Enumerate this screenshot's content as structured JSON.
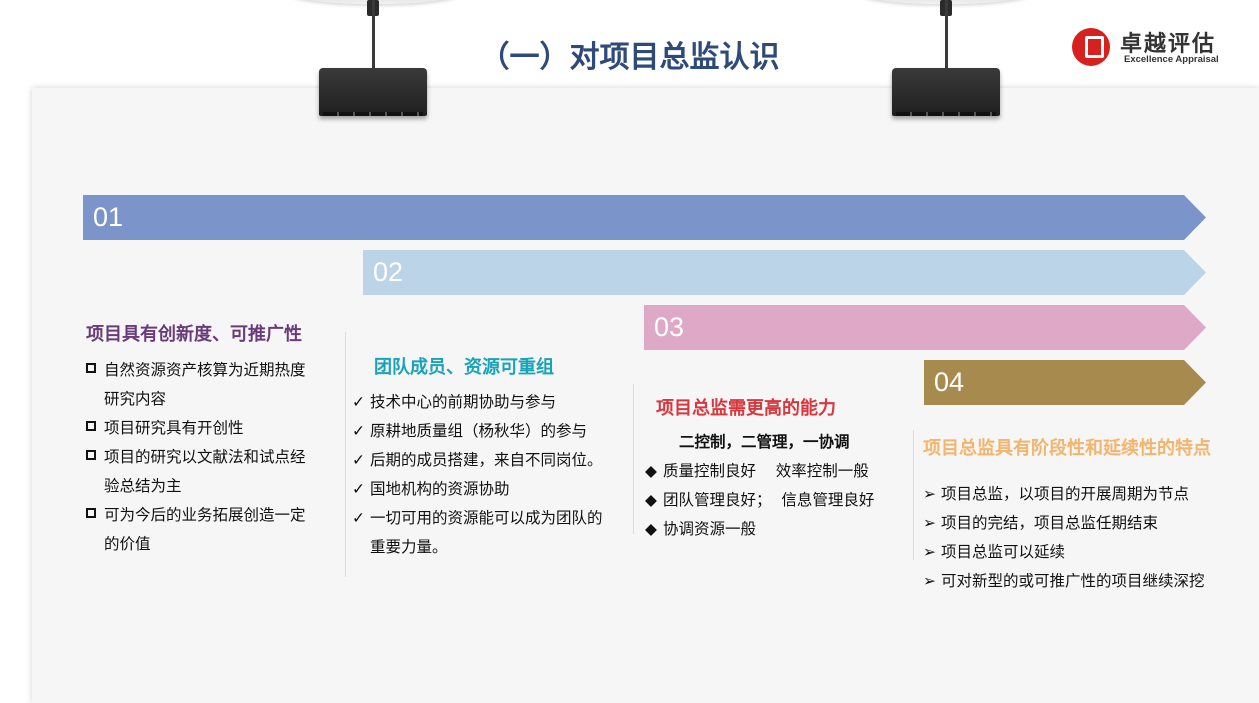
{
  "header": {
    "title": "（一）对项目总监认识",
    "logo_cn": "卓越评估",
    "logo_en": "Excellence Appraisal"
  },
  "steps": [
    "01",
    "02",
    "03",
    "04"
  ],
  "colors": {
    "step1": "#7b94ca",
    "step2": "#bcd4e7",
    "step3": "#dea9c6",
    "step4": "#a78b4e",
    "title": "#2e4a7a",
    "logo": "#d7211f"
  },
  "col1": {
    "heading": "项目具有创新度、可推广性",
    "bullet_icon": "hollow-square",
    "items": [
      "自然资源资产核算为近期热度",
      "研究内容",
      "项目研究具有开创性",
      "项目的研究以文献法和试点经",
      "验总结为主",
      "可为今后的业务拓展创造一定",
      "的价值"
    ]
  },
  "col2": {
    "heading": "团队成员、资源可重组",
    "bullet_icon": "check",
    "items": [
      "技术中心的前期协助与参与",
      "原耕地质量组（杨秋华）的参与",
      "后期的成员搭建，来自不同岗位。",
      "国地机构的资源协助",
      "一切可用的资源能可以成为团队的",
      "重要力量。"
    ]
  },
  "col3": {
    "heading": "项目总监需更高的能力",
    "sub": "二控制，二管理，一协调",
    "bullet_icon": "diamond",
    "items": [
      "质量控制良好    效率控制一般",
      "团队管理良好；  信息管理良好",
      "协调资源一般"
    ]
  },
  "col4": {
    "heading": "项目总监具有阶段性和延续性的特点",
    "bullet_icon": "chevron-right",
    "items": [
      "项目总监，以项目的开展周期为节点",
      "项目的完结，项目总监任期结束",
      "项目总监可以延续",
      "可对新型的或可推广性的项目继续深挖"
    ]
  }
}
